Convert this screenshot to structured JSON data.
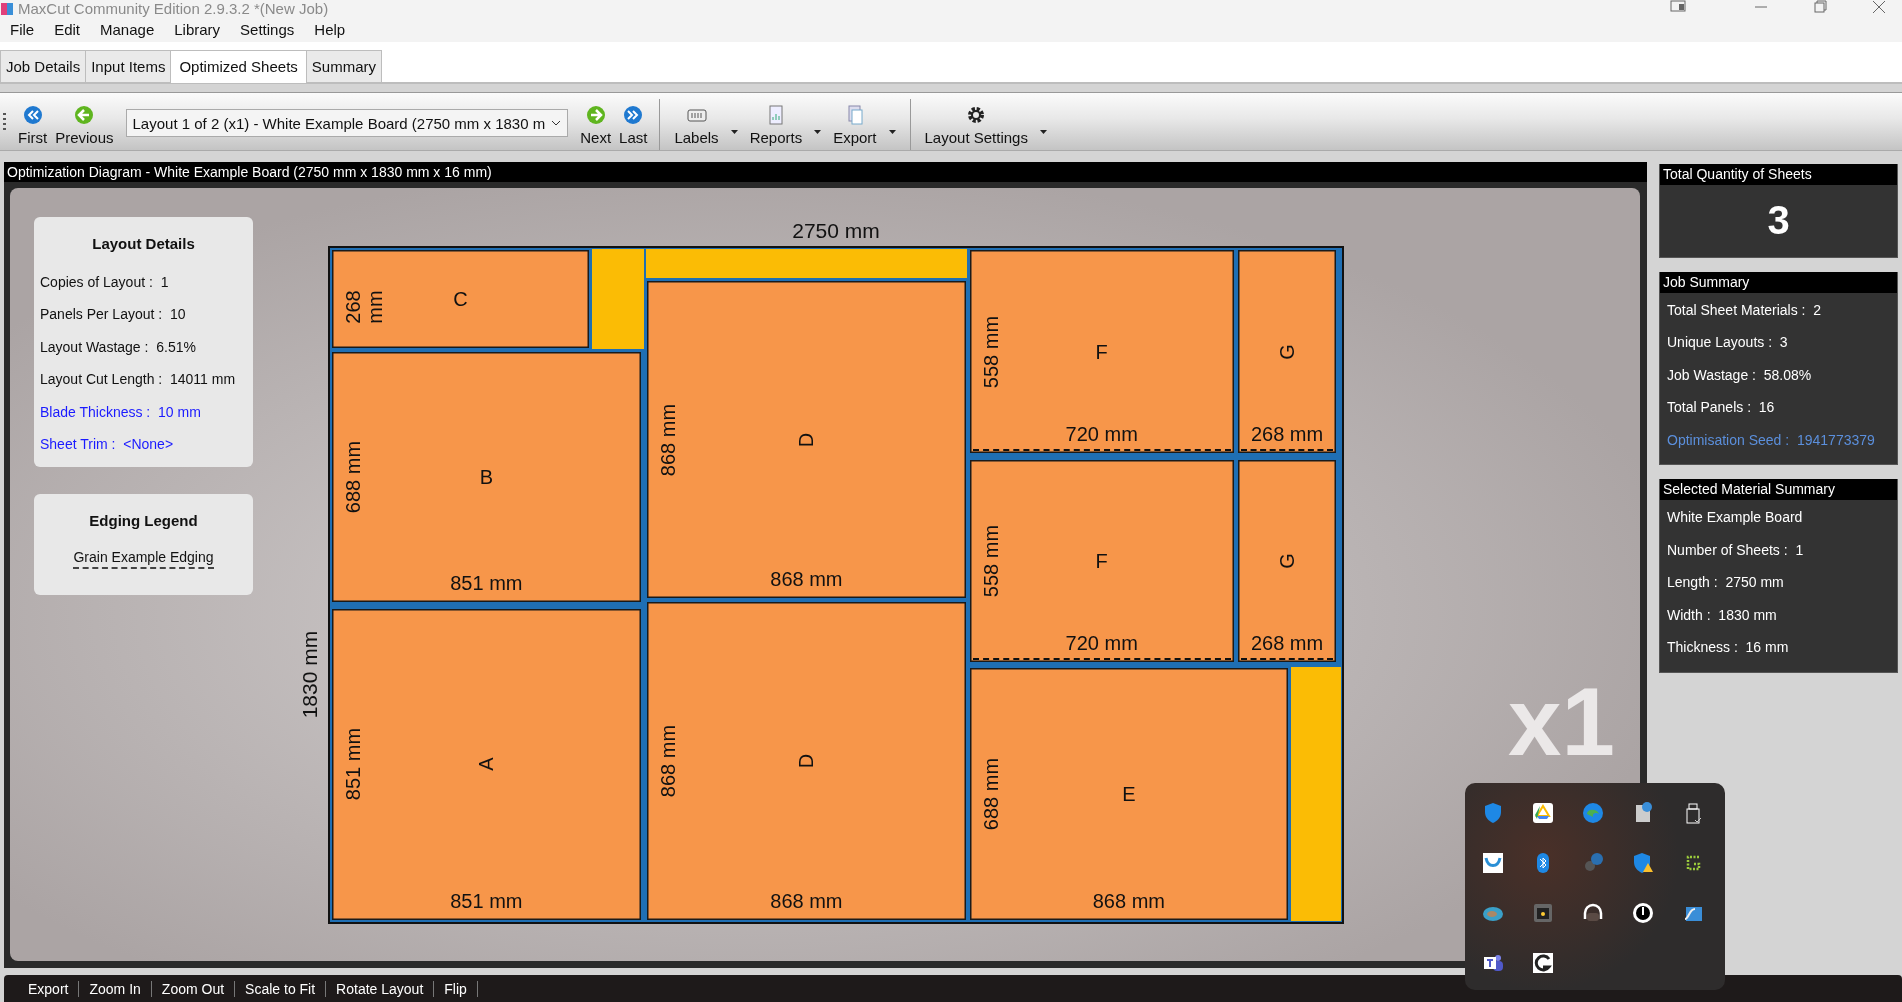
{
  "window": {
    "title": "MaxCut Community Edition 2.9.3.2 *(New Job)"
  },
  "menu": [
    "File",
    "Edit",
    "Manage",
    "Library",
    "Settings",
    "Help"
  ],
  "tabs": [
    {
      "label": "Job Details",
      "selected": false
    },
    {
      "label": "Input Items",
      "selected": false
    },
    {
      "label": "Optimized Sheets",
      "selected": true
    },
    {
      "label": "Summary",
      "selected": false
    }
  ],
  "toolbar": {
    "navigation_start": [
      "First",
      "Previous"
    ],
    "layout_select": {
      "value": "Layout 1 of 2 (x1) - White Example Board (2750 mm x 1830 m"
    },
    "navigation_end": [
      "Next",
      "Last"
    ],
    "menus": [
      "Labels",
      "Reports",
      "Export"
    ],
    "settings": "Layout Settings"
  },
  "diagram": {
    "title": "Optimization Diagram - White Example Board (2750 mm x 1830 mm x 16 mm)",
    "layout_details": {
      "title": "Layout Details",
      "rows": [
        {
          "text": "Copies of Layout :  1",
          "highlight": false
        },
        {
          "text": "Panels Per Layout :  10",
          "highlight": false
        },
        {
          "text": "Layout Wastage :  6.51%",
          "highlight": false
        },
        {
          "text": "Layout Cut Length :  14011 mm",
          "highlight": false
        },
        {
          "text": "Blade Thickness :  10 mm",
          "highlight": true
        },
        {
          "text": "Sheet Trim :  <None>",
          "highlight": true
        }
      ]
    },
    "edging_legend": {
      "title": "Edging Legend",
      "items": [
        "Grain Example Edging"
      ]
    },
    "sheet": {
      "width_label": "2750 mm",
      "height_label": "1830 mm",
      "copies": "x1",
      "panels": [
        {
          "label": "C",
          "rotated": false,
          "height_label": "268 mm",
          "edged": false
        },
        {
          "label": "B",
          "rotated": false,
          "height_label": "688 mm",
          "width_label": "851 mm",
          "edged": false
        },
        {
          "label": "A",
          "rotated": true,
          "height_label": "851 mm",
          "width_label": "851 mm",
          "edged": false
        },
        {
          "label": "D",
          "rotated": true,
          "height_label": "868 mm",
          "width_label": "868 mm",
          "edged": false
        },
        {
          "label": "D",
          "rotated": true,
          "height_label": "868 mm",
          "width_label": "868 mm",
          "edged": false
        },
        {
          "label": "F",
          "rotated": false,
          "height_label": "558 mm",
          "width_label": "720 mm",
          "edged": true
        },
        {
          "label": "G",
          "rotated": true,
          "width_label": "268 mm",
          "edged": true
        },
        {
          "label": "F",
          "rotated": false,
          "height_label": "558 mm",
          "width_label": "720 mm",
          "edged": true
        },
        {
          "label": "G",
          "rotated": true,
          "width_label": "268 mm",
          "edged": true
        },
        {
          "label": "E",
          "rotated": false,
          "height_label": "688 mm",
          "width_label": "868 mm",
          "edged": false
        }
      ]
    }
  },
  "total_sheets": {
    "title": "Total Quantity of Sheets",
    "value": "3"
  },
  "job_summary": {
    "title": "Job Summary",
    "rows": [
      {
        "text": "Total Sheet Materials :  2",
        "highlight": false
      },
      {
        "text": "Unique Layouts :  3",
        "highlight": false
      },
      {
        "text": "Job Wastage :  58.08%",
        "highlight": false
      },
      {
        "text": "Total Panels :  16",
        "highlight": false
      },
      {
        "text": "Optimisation Seed :  1941773379",
        "highlight": true
      }
    ]
  },
  "material_summary": {
    "title": "Selected Material Summary",
    "rows": [
      {
        "text": "White Example Board",
        "highlight": false
      },
      {
        "text": "Number of Sheets :  1",
        "highlight": false
      },
      {
        "text": "Length :  2750 mm",
        "highlight": false
      },
      {
        "text": "Width :  1830 mm",
        "highlight": false
      },
      {
        "text": "Thickness :  16 mm",
        "highlight": false
      }
    ]
  },
  "bottom_bar": [
    "Export",
    "Zoom In",
    "Zoom Out",
    "Scale to Fit",
    "Rotate Layout",
    "Flip"
  ]
}
